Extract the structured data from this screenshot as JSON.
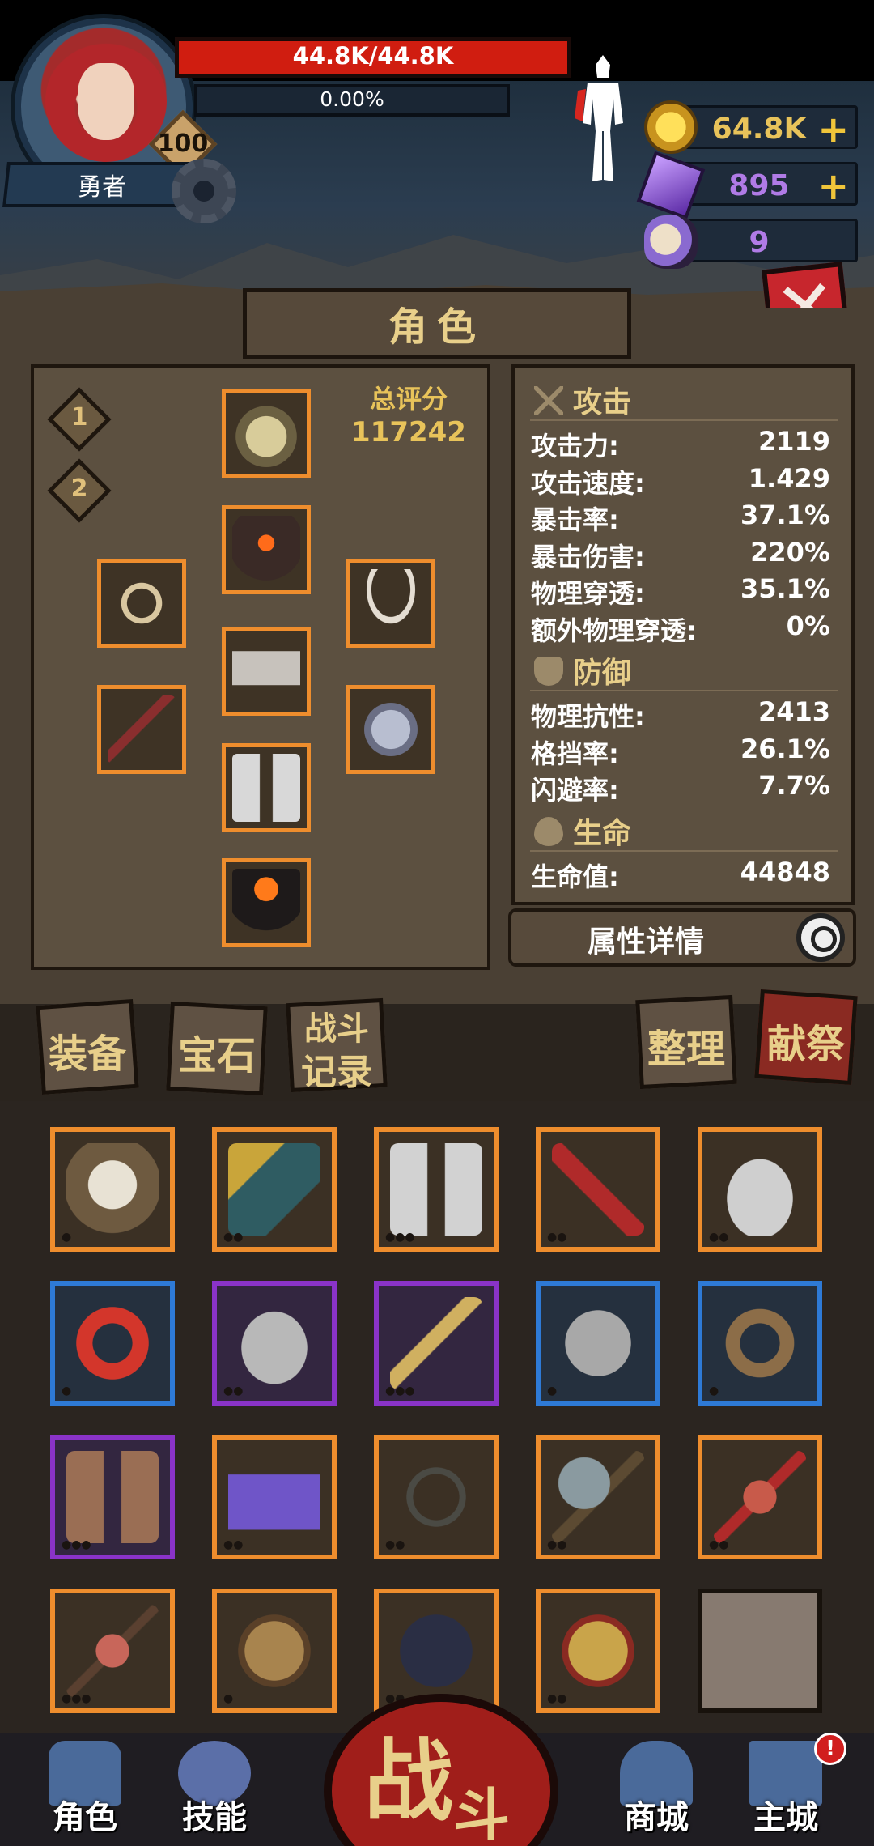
{
  "player": {
    "name": "勇者",
    "level": "100",
    "hp_text": "44.8K/44.8K",
    "xp_text": "0.00%",
    "xp_fraction": 0.0
  },
  "currency": {
    "gold": "64.8K",
    "gems": "895",
    "skulls": "9",
    "plus": "+"
  },
  "panel": {
    "title": "角色",
    "close_label": "✕",
    "tiers": [
      "1",
      "2"
    ],
    "score_label": "总评分",
    "score_value": "117242",
    "detail_button": "属性详情"
  },
  "stats": {
    "attack_title": "攻击",
    "attack": [
      {
        "k": "攻击力:",
        "v": "2119"
      },
      {
        "k": "攻击速度:",
        "v": "1.429"
      },
      {
        "k": "暴击率:",
        "v": "37.1%"
      },
      {
        "k": "暴击伤害:",
        "v": "220%"
      },
      {
        "k": "物理穿透:",
        "v": "35.1%"
      },
      {
        "k": "额外物理穿透:",
        "v": "0%"
      }
    ],
    "defense_title": "防御",
    "defense": [
      {
        "k": "物理抗性:",
        "v": "2413"
      },
      {
        "k": "格挡率:",
        "v": "26.1%"
      },
      {
        "k": "闪避率:",
        "v": "7.7%"
      }
    ],
    "life_title": "生命",
    "life": [
      {
        "k": "生命值:",
        "v": "44848"
      }
    ]
  },
  "tabs": {
    "equipment": "装备",
    "gems": "宝石",
    "battle_log_1": "战斗",
    "battle_log_2": "记录",
    "sort": "整理",
    "sacrifice": "献祭"
  },
  "nav": {
    "character": "角色",
    "skills": "技能",
    "battle_1": "战",
    "battle_2": "斗",
    "shop": "商城",
    "city": "主城",
    "city_badge": "!"
  },
  "colors": {
    "rarity_orange": "#ee8d2d",
    "rarity_blue": "#2e7ad6",
    "rarity_purple": "#8a33c8",
    "accent_gold": "#e8cf8a",
    "hp_red": "#d01d10"
  },
  "inventory_icons": [
    [
      "ram-skull-shield-icon",
      "golden-claw-icon",
      "arm-guards-icon",
      "red-blade-icon",
      "plated-boots-icon"
    ],
    [
      "red-headband-icon",
      "iron-boots-icon",
      "golden-sword-icon",
      "scale-armor-icon",
      "leather-belt-icon"
    ],
    [
      "leather-bracers-icon",
      "purple-skirt-icon",
      "thorn-whip-icon",
      "battle-axe-icon",
      "fire-staff-icon"
    ],
    [
      "spear-icon",
      "round-shield-icon",
      "dark-boots-icon",
      "golden-armor-icon",
      "empty-slot"
    ]
  ]
}
